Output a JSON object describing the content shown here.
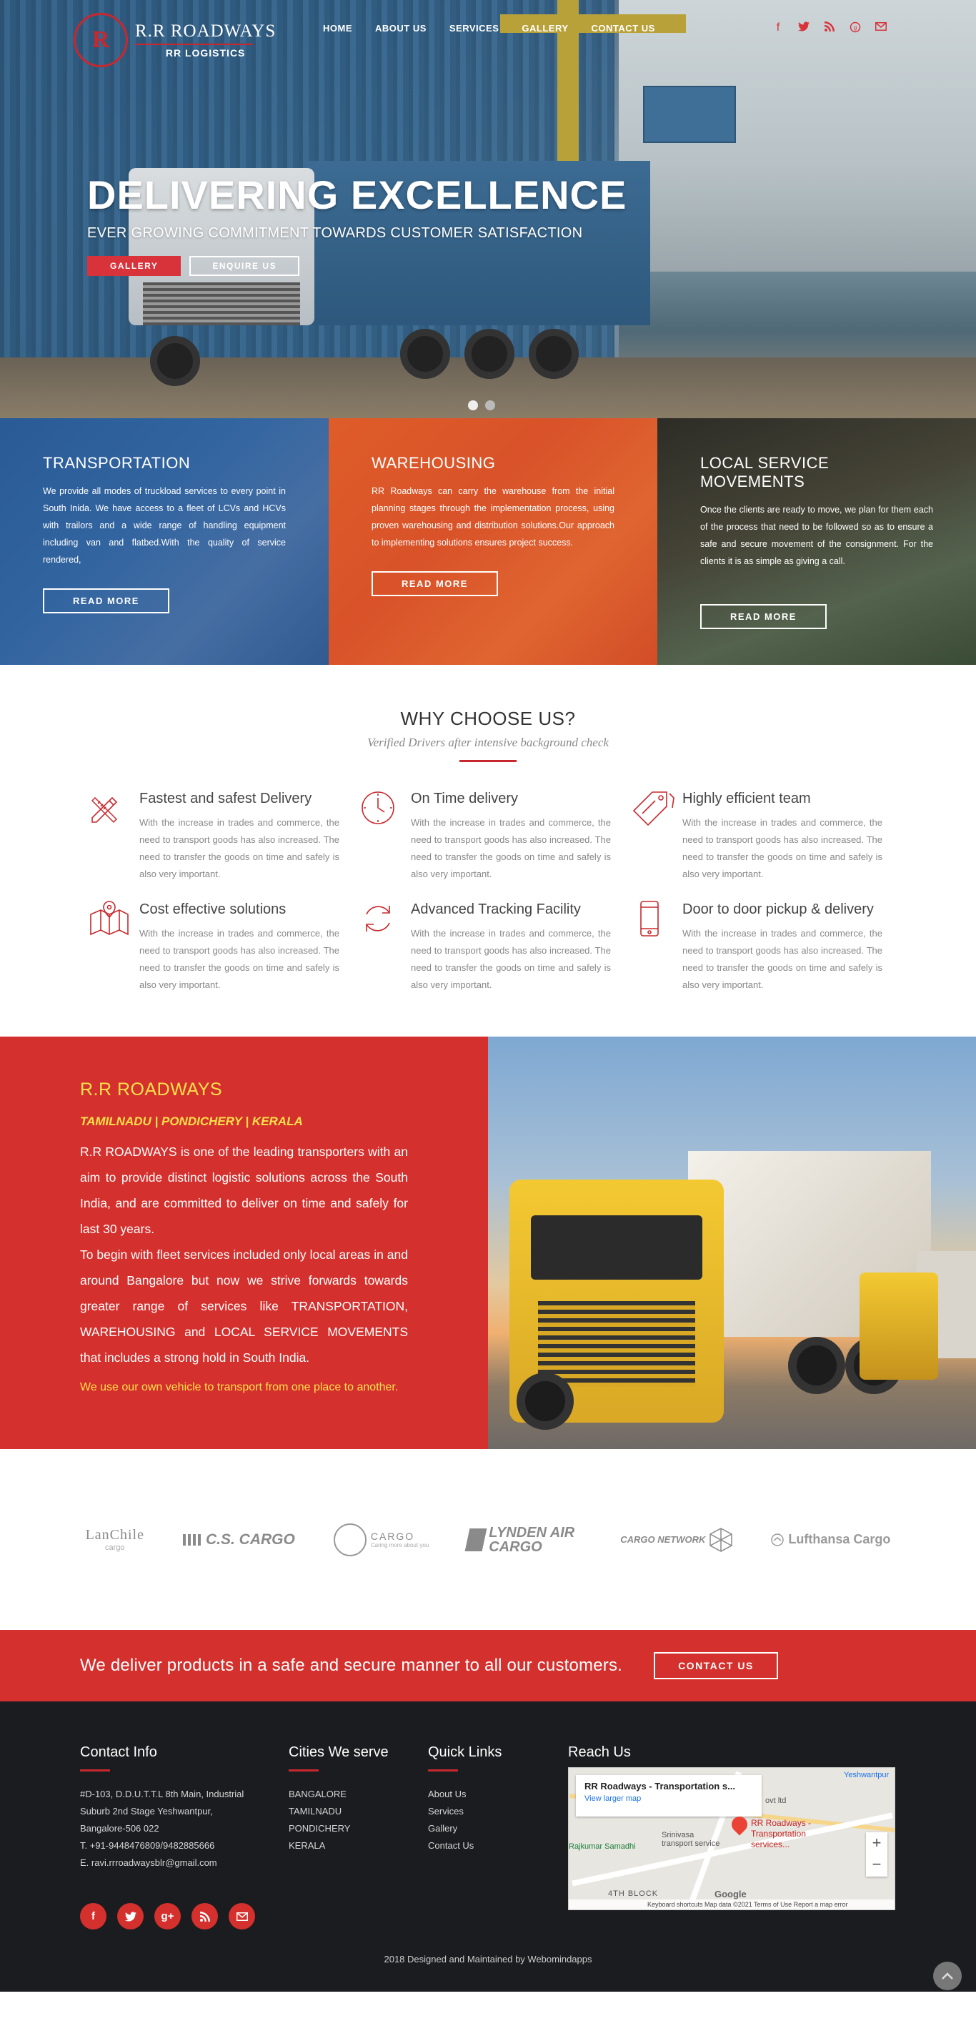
{
  "brand": {
    "mark": "R",
    "name": "R.R ROADWAYS",
    "sub": "RR LOGISTICS"
  },
  "nav": {
    "items": [
      "HOME",
      "ABOUT US",
      "SERVICES",
      "GALLERY",
      "CONTACT US"
    ]
  },
  "top_social": [
    "facebook-icon",
    "twitter-icon",
    "rss-icon",
    "google-plus-icon",
    "mail-icon"
  ],
  "hero": {
    "title": "DELIVERING EXCELLENCE",
    "subtitle": "EVER GROWING COMMITMENT TOWARDS CUSTOMER SATISFACTION",
    "btn_gallery": "GALLERY",
    "btn_enquire": "ENQUIRE US",
    "slides": 2,
    "active_slide": 1
  },
  "services": [
    {
      "title": "TRANSPORTATION",
      "text": "We provide all modes of truckload services to every point in South Inida. We have access to a fleet of LCVs and HCVs with trailors and a wide range of handling equipment including van and flatbed.With the quality of service rendered,",
      "button": "READ MORE"
    },
    {
      "title": "WAREHOUSING",
      "text": "RR Roadways can carry the warehouse from the initial planning stages through the implementation process, using proven warehousing and distribution solutions.Our approach to implementing solutions ensures project success.",
      "button": "READ MORE"
    },
    {
      "title": "LOCAL SERVICE MOVEMENTS",
      "text": "Once the clients are ready to move, we plan for them each of the process that need to be followed so as to ensure a safe and secure movement of the consignment. For the clients it is as simple as giving a call.",
      "button": "READ MORE"
    }
  ],
  "why": {
    "title": "WHY CHOOSE US?",
    "tagline": "Verified Drivers after intensive background check",
    "features": [
      {
        "icon": "pencil-ruler-icon",
        "title": "Fastest and safest Delivery",
        "text": "With the increase in trades and commerce, the need to transport goods has also increased. The need to transfer the goods on time and safely is also very important."
      },
      {
        "icon": "clock-icon",
        "title": "On Time delivery",
        "text": "With the increase in trades and commerce, the need to transport goods has also increased. The need to transfer the goods on time and safely is also very important."
      },
      {
        "icon": "price-tags-icon",
        "title": "Highly efficient team",
        "text": "With the increase in trades and commerce, the need to transport goods has also increased. The need to transfer the goods on time and safely is also very important."
      },
      {
        "icon": "map-icon",
        "title": "Cost effective solutions",
        "text": "With the increase in trades and commerce, the need to transport goods has also increased. The need to transfer the goods on time and safely is also very important."
      },
      {
        "icon": "refresh-icon",
        "title": "Advanced Tracking Facility",
        "text": "With the increase in trades and commerce, the need to transport goods has also increased. The need to transfer the goods on time and safely is also very important."
      },
      {
        "icon": "mobile-phone-icon",
        "title": "Door to door pickup & delivery",
        "text": "With the increase in trades and commerce, the need to transport goods has also increased. The need to transfer the goods on time and safely is also very important."
      }
    ]
  },
  "about": {
    "title": "R.R ROADWAYS",
    "regions": "TAMILNADU | PONDICHERY | KERALA",
    "para1": "R.R ROADWAYS is one of the leading transporters with an aim to provide distinct logistic solutions across the South India, and are committed to deliver on time and safely for last 30 years.",
    "para2": "To begin with fleet services included only local areas in and around Bangalore but now we strive forwards towards greater range of services like TRANSPORTATION, WAREHOUSING and LOCAL SERVICE MOVEMENTS that includes a strong hold in South India.",
    "note": "We use our own vehicle to transport from one place to another."
  },
  "partners": [
    {
      "name": "LanChile",
      "sub": "cargo"
    },
    {
      "name": "C.S. CARGO"
    },
    {
      "name": "CARGO",
      "sub": "Caring more about you"
    },
    {
      "name": "LYNDEN AIR CARGO"
    },
    {
      "name": "CARGO NETWORK"
    },
    {
      "name": "Lufthansa Cargo"
    }
  ],
  "cta": {
    "text": "We deliver products in a safe and secure manner to all our customers.",
    "button": "CONTACT US"
  },
  "footer": {
    "contact": {
      "title": "Contact Info",
      "lines": [
        "#D-103, D.D.U.T.T.L 8th Main, Industrial",
        "Suburb 2nd Stage Yeshwantpur,",
        "Bangalore-506 022",
        "T. +91-9448476809/9482885666",
        "E. ravi.rrroadwaysblr@gmail.com"
      ]
    },
    "cities": {
      "title": "Cities We serve",
      "items": [
        "BANGALORE",
        "TAMILNADU",
        "PONDICHERY",
        "KERALA"
      ]
    },
    "links": {
      "title": "Quick Links",
      "items": [
        "About Us",
        "Services",
        "Gallery",
        "Contact Us"
      ]
    },
    "reach": {
      "title": "Reach Us",
      "map_title": "RR Roadways - Transportation s...",
      "map_link": "View larger map",
      "pin_label": "RR Roadways - Transportation services...",
      "labels": [
        "Yeshwantpur",
        "Srinivasa transport service",
        "Rajkumar Samadhi",
        "4TH BLOCK",
        "ovt ltd"
      ],
      "map_footer": "Keyboard shortcuts  Map data ©2021  Terms of Use  Report a map error",
      "google": "Google"
    },
    "social": [
      "f",
      "t",
      "g+",
      "rss",
      "mail"
    ],
    "copyright": "2018 Designed and Maintained by Webomindapps"
  }
}
